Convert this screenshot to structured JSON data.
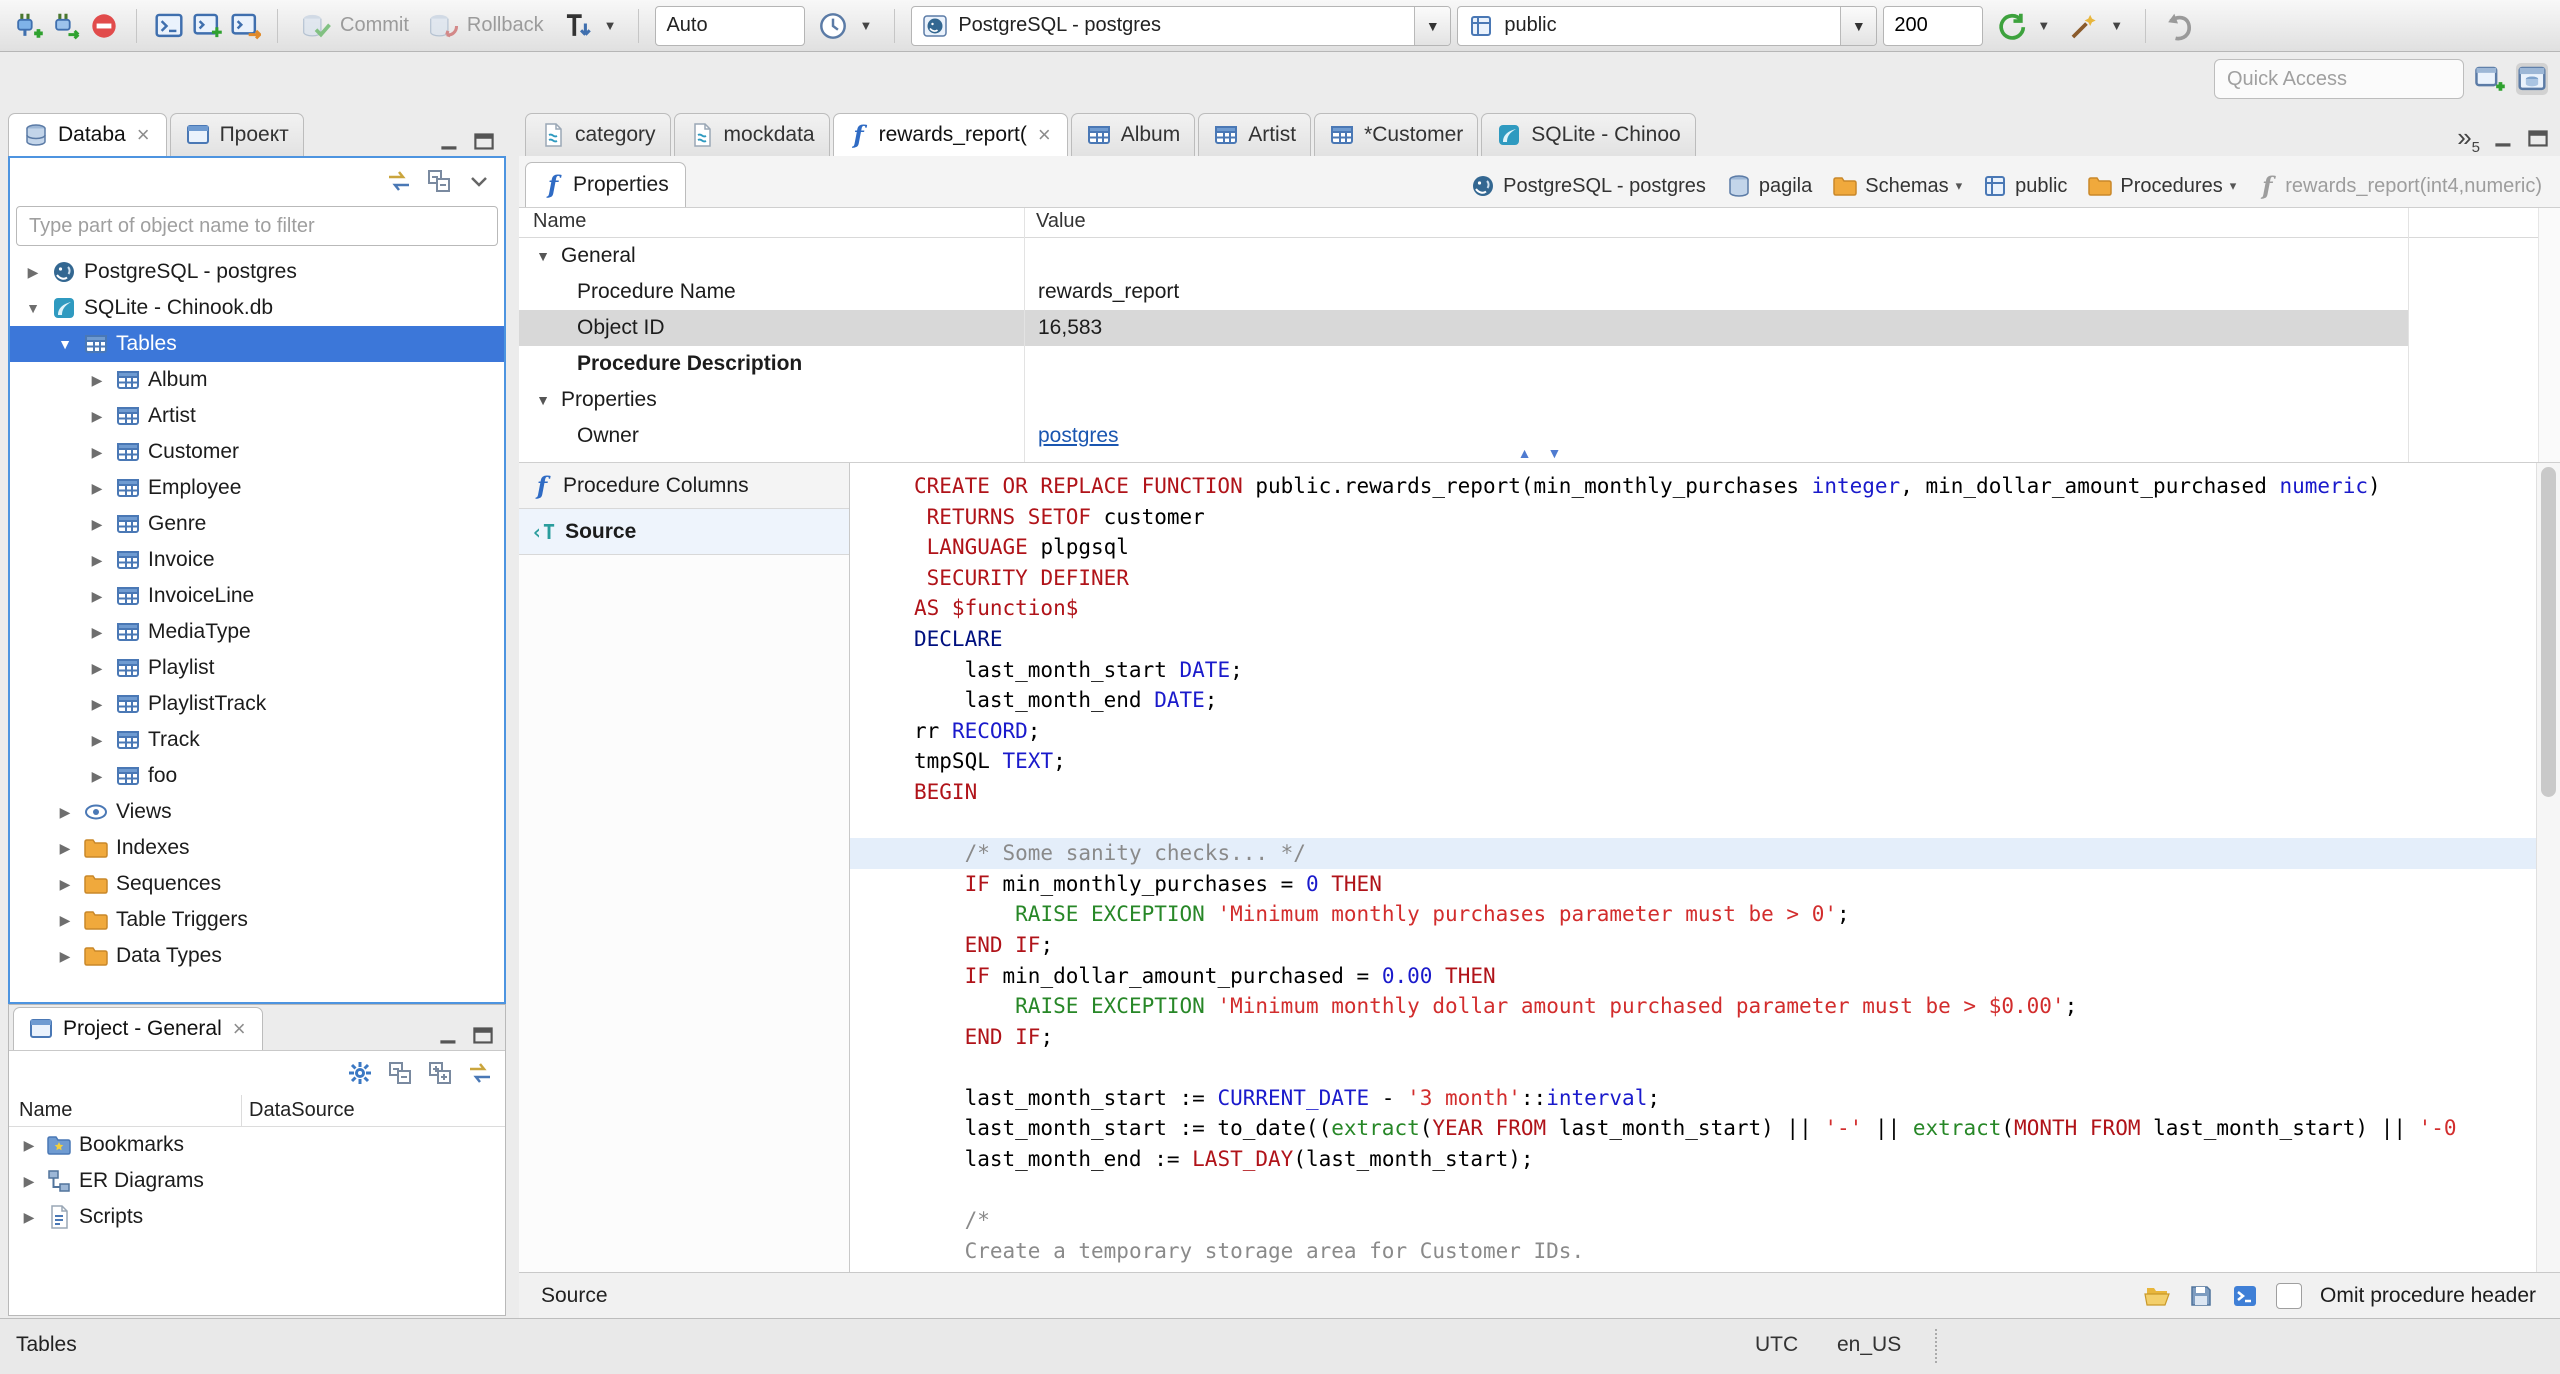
{
  "toolbar": {
    "commit_label": "Commit",
    "rollback_label": "Rollback",
    "auto_label": "Auto",
    "connection_value": "PostgreSQL - postgres",
    "schema_value": "public",
    "fetch_size_value": "200",
    "quick_access_placeholder": "Quick Access"
  },
  "navigator": {
    "tabs": [
      {
        "label": "Databa",
        "icon": "db",
        "active": true,
        "closable": true
      },
      {
        "label": "Проект",
        "icon": "window"
      }
    ],
    "filter_placeholder": "Type part of object name to filter",
    "tree": [
      {
        "label": "PostgreSQL - postgres",
        "icon": "postgres",
        "level": 0,
        "expanded": false
      },
      {
        "label": "SQLite - Chinook.db",
        "icon": "sqlite",
        "level": 0,
        "expanded": true
      },
      {
        "label": "Tables",
        "icon": "table",
        "level": 1,
        "expanded": true,
        "selected": true
      },
      {
        "label": "Album",
        "icon": "table",
        "level": 2
      },
      {
        "label": "Artist",
        "icon": "table",
        "level": 2
      },
      {
        "label": "Customer",
        "icon": "table",
        "level": 2
      },
      {
        "label": "Employee",
        "icon": "table",
        "level": 2
      },
      {
        "label": "Genre",
        "icon": "table",
        "level": 2
      },
      {
        "label": "Invoice",
        "icon": "table",
        "level": 2
      },
      {
        "label": "InvoiceLine",
        "icon": "table",
        "level": 2
      },
      {
        "label": "MediaType",
        "icon": "table",
        "level": 2
      },
      {
        "label": "Playlist",
        "icon": "table",
        "level": 2
      },
      {
        "label": "PlaylistTrack",
        "icon": "table",
        "level": 2
      },
      {
        "label": "Track",
        "icon": "table",
        "level": 2
      },
      {
        "label": "foo",
        "icon": "table",
        "level": 2
      },
      {
        "label": "Views",
        "icon": "view",
        "level": 1
      },
      {
        "label": "Indexes",
        "icon": "folder",
        "level": 1
      },
      {
        "label": "Sequences",
        "icon": "folder",
        "level": 1
      },
      {
        "label": "Table Triggers",
        "icon": "folder",
        "level": 1
      },
      {
        "label": "Data Types",
        "icon": "folder",
        "level": 1
      }
    ]
  },
  "project_panel": {
    "title": "Project - General",
    "columns": [
      "Name",
      "DataSource"
    ],
    "items": [
      {
        "label": "Bookmarks",
        "icon": "bookmarks"
      },
      {
        "label": "ER Diagrams",
        "icon": "er"
      },
      {
        "label": "Scripts",
        "icon": "scripts"
      }
    ]
  },
  "editor_tabs": {
    "tabs": [
      {
        "label": "category",
        "icon": "sqlfile"
      },
      {
        "label": "mockdata",
        "icon": "sqlfile"
      },
      {
        "label": "rewards_report(",
        "icon": "function",
        "active": true,
        "closable": true
      },
      {
        "label": "Album",
        "icon": "table"
      },
      {
        "label": "Artist",
        "icon": "table"
      },
      {
        "label": "*Customer",
        "icon": "table"
      },
      {
        "label": "SQLite - Chinoo",
        "icon": "sqlite"
      }
    ],
    "overflow_count": "5"
  },
  "properties_view": {
    "tab_label": "Properties",
    "breadcrumb": [
      {
        "label": "PostgreSQL - postgres",
        "icon": "postgres"
      },
      {
        "label": "pagila",
        "icon": "dbcyl"
      },
      {
        "label": "Schemas",
        "icon": "folder",
        "dropdown": true
      },
      {
        "label": "public",
        "icon": "schema"
      },
      {
        "label": "Procedures",
        "icon": "folder",
        "dropdown": true
      },
      {
        "label": "rewards_report(int4,numeric)",
        "icon": "function",
        "muted": true
      }
    ],
    "grid": {
      "columns": [
        "Name",
        "Value"
      ],
      "rows": [
        {
          "name": "General",
          "group": true
        },
        {
          "name": "Procedure Name",
          "value": "rewards_report"
        },
        {
          "name": "Object ID",
          "value": "16,583",
          "selected": true
        },
        {
          "name": "Procedure Description",
          "bold": true
        },
        {
          "name": "Properties",
          "group": true
        },
        {
          "name": "Owner",
          "value": "postgres",
          "link": true
        }
      ]
    },
    "sub_tabs": [
      {
        "label": "Procedure Columns",
        "icon": "function"
      },
      {
        "label": "Source",
        "icon": "source",
        "active": true
      }
    ]
  },
  "source_editor": {
    "lines": [
      {
        "tokens": [
          [
            "k",
            "CREATE OR REPLACE FUNCTION "
          ],
          [
            "p",
            "public.rewards_report(min_monthly_purchases "
          ],
          [
            "t",
            "integer"
          ],
          [
            "p",
            ", min_dollar_amount_purchased "
          ],
          [
            "t",
            "numeric"
          ],
          [
            "p",
            ")"
          ]
        ]
      },
      {
        "tokens": [
          [
            "p",
            " "
          ],
          [
            "k",
            "RETURNS SETOF "
          ],
          [
            "p",
            "customer"
          ]
        ]
      },
      {
        "tokens": [
          [
            "p",
            " "
          ],
          [
            "k",
            "LANGUAGE "
          ],
          [
            "p",
            "plpgsql"
          ]
        ]
      },
      {
        "tokens": [
          [
            "p",
            " "
          ],
          [
            "k",
            "SECURITY DEFINER"
          ]
        ]
      },
      {
        "tokens": [
          [
            "k",
            "AS $function$"
          ]
        ]
      },
      {
        "tokens": [
          [
            "d",
            "DECLARE"
          ]
        ]
      },
      {
        "tokens": [
          [
            "p",
            "    last_month_start "
          ],
          [
            "t",
            "DATE"
          ],
          [
            "p",
            ";"
          ]
        ]
      },
      {
        "tokens": [
          [
            "p",
            "    last_month_end "
          ],
          [
            "t",
            "DATE"
          ],
          [
            "p",
            ";"
          ]
        ]
      },
      {
        "tokens": [
          [
            "p",
            "rr "
          ],
          [
            "t",
            "RECORD"
          ],
          [
            "p",
            ";"
          ]
        ]
      },
      {
        "tokens": [
          [
            "p",
            "tmpSQL "
          ],
          [
            "t",
            "TEXT"
          ],
          [
            "p",
            ";"
          ]
        ]
      },
      {
        "tokens": [
          [
            "k",
            "BEGIN"
          ]
        ]
      },
      {
        "tokens": []
      },
      {
        "hl": true,
        "tokens": [
          [
            "p",
            "    "
          ],
          [
            "c",
            "/* Some sanity checks... */"
          ]
        ]
      },
      {
        "tokens": [
          [
            "p",
            "    "
          ],
          [
            "k",
            "IF"
          ],
          [
            "p",
            " min_monthly_purchases = "
          ],
          [
            "n",
            "0"
          ],
          [
            "p",
            " "
          ],
          [
            "k",
            "THEN"
          ]
        ]
      },
      {
        "tokens": [
          [
            "p",
            "        "
          ],
          [
            "f",
            "RAISE EXCEPTION"
          ],
          [
            "p",
            " "
          ],
          [
            "s",
            "'Minimum monthly purchases parameter must be > 0'"
          ],
          [
            "p",
            ";"
          ]
        ]
      },
      {
        "tokens": [
          [
            "p",
            "    "
          ],
          [
            "k",
            "END IF"
          ],
          [
            "p",
            ";"
          ]
        ]
      },
      {
        "tokens": [
          [
            "p",
            "    "
          ],
          [
            "k",
            "IF"
          ],
          [
            "p",
            " min_dollar_amount_purchased = "
          ],
          [
            "n",
            "0.00"
          ],
          [
            "p",
            " "
          ],
          [
            "k",
            "THEN"
          ]
        ]
      },
      {
        "tokens": [
          [
            "p",
            "        "
          ],
          [
            "f",
            "RAISE EXCEPTION"
          ],
          [
            "p",
            " "
          ],
          [
            "s",
            "'Minimum monthly dollar amount purchased parameter must be > $0.00'"
          ],
          [
            "p",
            ";"
          ]
        ]
      },
      {
        "tokens": [
          [
            "p",
            "    "
          ],
          [
            "k",
            "END IF"
          ],
          [
            "p",
            ";"
          ]
        ]
      },
      {
        "tokens": []
      },
      {
        "tokens": [
          [
            "p",
            "    last_month_start := "
          ],
          [
            "t",
            "CURRENT_DATE"
          ],
          [
            "p",
            " - "
          ],
          [
            "s",
            "'3 month'"
          ],
          [
            "p",
            "::"
          ],
          [
            "t",
            "interval"
          ],
          [
            "p",
            ";"
          ]
        ]
      },
      {
        "tokens": [
          [
            "p",
            "    last_month_start := to_date(("
          ],
          [
            "f",
            "extract"
          ],
          [
            "p",
            "("
          ],
          [
            "k",
            "YEAR FROM"
          ],
          [
            "p",
            " last_month_start) || "
          ],
          [
            "s",
            "'-'"
          ],
          [
            "p",
            " || "
          ],
          [
            "f",
            "extract"
          ],
          [
            "p",
            "("
          ],
          [
            "k",
            "MONTH FROM"
          ],
          [
            "p",
            " last_month_start) || "
          ],
          [
            "s",
            "'-0"
          ]
        ]
      },
      {
        "tokens": [
          [
            "p",
            "    last_month_end := "
          ],
          [
            "k",
            "LAST_DAY"
          ],
          [
            "p",
            "(last_month_start);"
          ]
        ]
      },
      {
        "tokens": []
      },
      {
        "tokens": [
          [
            "p",
            "    "
          ],
          [
            "c",
            "/*"
          ]
        ]
      },
      {
        "tokens": [
          [
            "p",
            "    "
          ],
          [
            "c",
            "Create a temporary storage area for Customer IDs."
          ]
        ]
      },
      {
        "tokens": [
          [
            "p",
            "    "
          ],
          [
            "c",
            "*/"
          ]
        ]
      }
    ]
  },
  "source_bar": {
    "label": "Source",
    "omit_label": "Omit procedure header"
  },
  "status_bar": {
    "left": "Tables",
    "timezone": "UTC",
    "locale": "en_US"
  }
}
